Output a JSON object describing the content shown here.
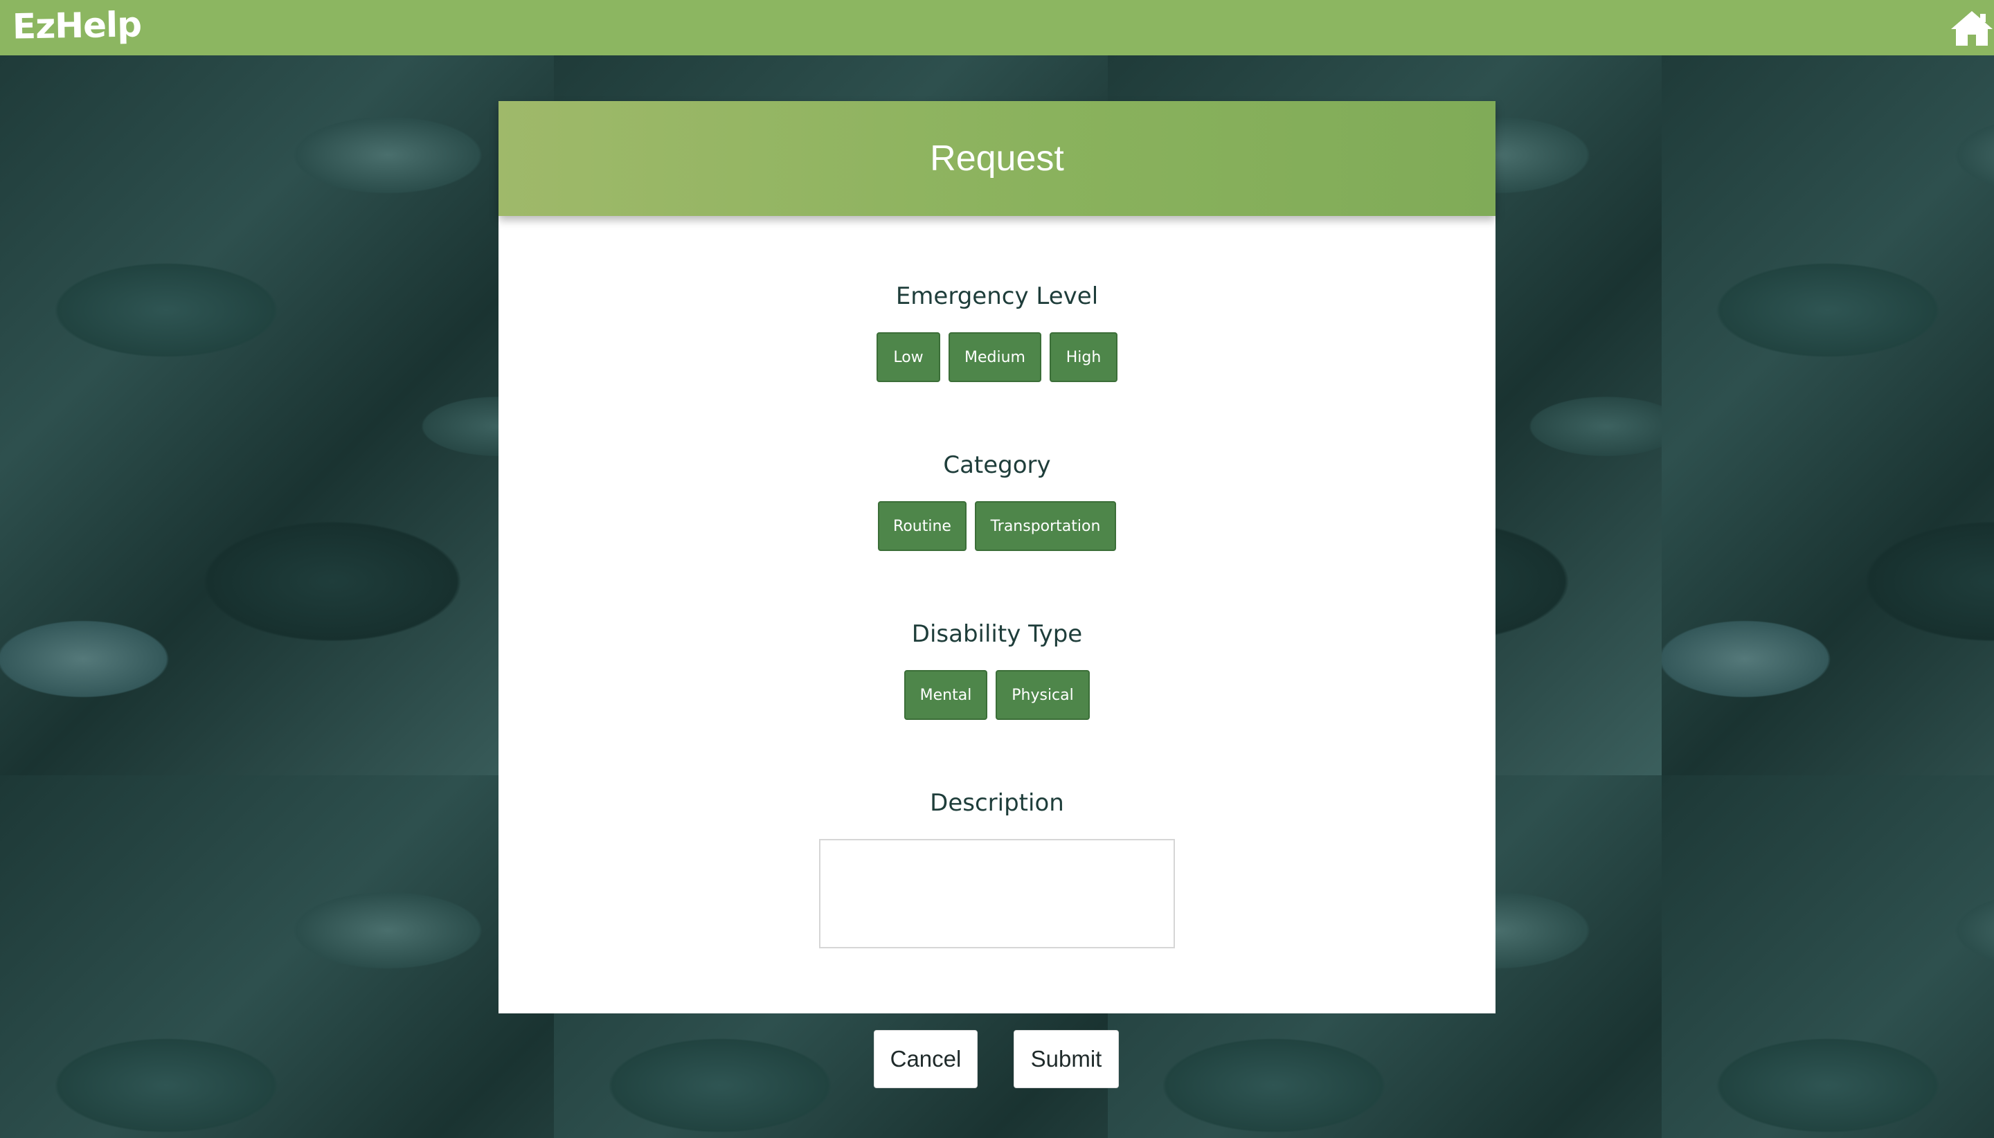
{
  "app": {
    "brand": "EzHelp",
    "home_icon": "home-icon"
  },
  "colors": {
    "topbar": "#8cb661",
    "button": "#4e864a",
    "label": "#1e3d3a"
  },
  "form": {
    "title": "Request",
    "emergency": {
      "label": "Emergency Level",
      "options": [
        "Low",
        "Medium",
        "High"
      ]
    },
    "category": {
      "label": "Category",
      "options": [
        "Routine",
        "Transportation"
      ]
    },
    "disability": {
      "label": "Disability Type",
      "options": [
        "Mental",
        "Physical"
      ]
    },
    "description": {
      "label": "Description",
      "value": "",
      "placeholder": ""
    }
  },
  "actions": {
    "cancel": "Cancel",
    "submit": "Submit"
  }
}
